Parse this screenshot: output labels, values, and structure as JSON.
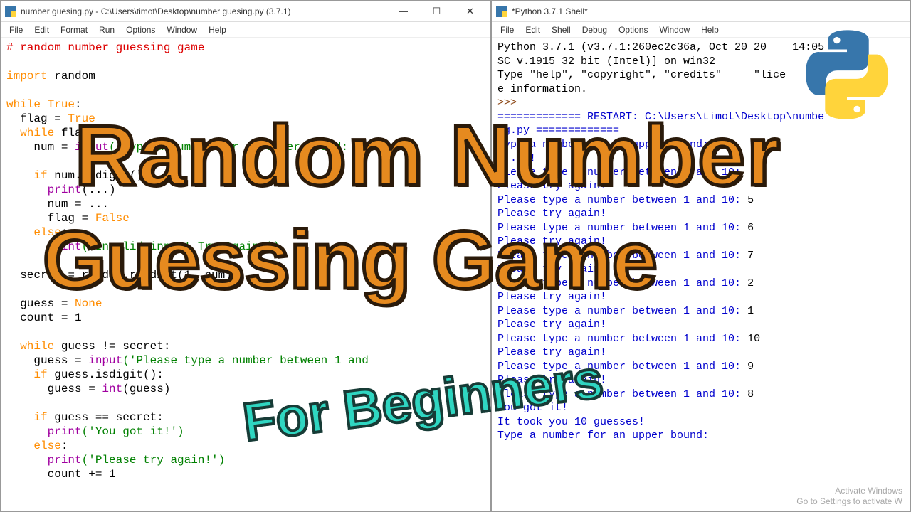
{
  "editor_window": {
    "title": "number guesing.py - C:\\Users\\timot\\Desktop\\number guesing.py (3.7.1)",
    "menu": [
      "File",
      "Edit",
      "Format",
      "Run",
      "Options",
      "Window",
      "Help"
    ],
    "code": {
      "l1_comment": "# random number guessing game",
      "l3_import": "import",
      "l3_random": " random",
      "l5_while": "while",
      "l5_true": " True",
      "l6_flag": "  flag = ",
      "l6_true": "True",
      "l7_while": "  while",
      "l7_flag": " flag:",
      "l8_num": "    num = ",
      "l8_input": "input",
      "l8_str": "('Type a number for an upper bound: ')",
      "l10_if": "    if",
      "l10_rest": " num.isdigit():",
      "l11_print": "      print",
      "l11_rest": "(...)",
      "l12_num": "      num = ...",
      "l13_flag": "      flag = ",
      "l13_false": "False",
      "l14_else": "    else",
      "l15_print": "      print",
      "l15_str": "('Invalid input! Try Again!')",
      "l17_secret": "  secret = ",
      "l17_rest": "random.randint(1, num)",
      "l19_guess": "  guess = ",
      "l19_none": "None",
      "l20_count": "  count = 1",
      "l22_while": "  while",
      "l22_rest": " guess != secret:",
      "l23_guess": "    guess = ",
      "l23_input": "input",
      "l23_str": "('Please type a number between 1 and ",
      "l24_if": "    if",
      "l24_rest": " guess.isdigit():",
      "l25_guess": "      guess = ",
      "l25_int": "int",
      "l25_rest": "(guess)",
      "l27_if": "    if",
      "l27_rest": " guess == secret:",
      "l28_print": "      print",
      "l28_str": "('You got it!')",
      "l29_else": "    else",
      "l30_print": "      print",
      "l30_str": "('Please try again!')",
      "l31_count": "      count += 1"
    }
  },
  "shell_window": {
    "title": "*Python 3.7.1 Shell*",
    "menu": [
      "File",
      "Edit",
      "Shell",
      "Debug",
      "Options",
      "Window",
      "Help"
    ],
    "header1": "Python 3.7.1 (v3.7.1:260ec2c36a, Oct 20 20    14:05",
    "header2": "SC v.1915 32 bit (Intel)] on win32",
    "header3": "Type \"help\", \"copyright\", \"credits\"     \"lice    \"",
    "header4": "e information.",
    "prompt": ">>> ",
    "restart": "============= RESTART: C:\\Users\\timot\\Desktop\\numbe",
    "restart2": "ng.py =============",
    "lines": [
      {
        "t": "prompt",
        "text": "Type a number for an upper bound: ",
        "val": "10"
      },
      {
        "t": "out",
        "text": "...ay!"
      },
      {
        "t": "prompt",
        "text": "Please type a number between 1 and 10: ",
        "val": ""
      },
      {
        "t": "out",
        "text": "Please try again!"
      },
      {
        "t": "prompt",
        "text": "Please type a number between 1 and 10: ",
        "val": "5"
      },
      {
        "t": "out",
        "text": "Please try again!"
      },
      {
        "t": "prompt",
        "text": "Please type a number between 1 and 10: ",
        "val": "6"
      },
      {
        "t": "out",
        "text": "Please try again!"
      },
      {
        "t": "prompt",
        "text": "Please type a number between 1 and 10: ",
        "val": "7"
      },
      {
        "t": "out",
        "text": "Please try again!"
      },
      {
        "t": "prompt",
        "text": "Please type a number between 1 and 10: ",
        "val": "2"
      },
      {
        "t": "out",
        "text": "Please try again!"
      },
      {
        "t": "prompt",
        "text": "Please type a number between 1 and 10: ",
        "val": "1"
      },
      {
        "t": "out",
        "text": "Please try again!"
      },
      {
        "t": "prompt",
        "text": "Please type a number between 1 and 10: ",
        "val": "10"
      },
      {
        "t": "out",
        "text": "Please try again!"
      },
      {
        "t": "prompt",
        "text": "Please type a number between 1 and 10: ",
        "val": "9"
      },
      {
        "t": "out",
        "text": "Please try again!"
      },
      {
        "t": "prompt",
        "text": "Please type a number between 1 and 10: ",
        "val": "8"
      },
      {
        "t": "out",
        "text": "You got it!"
      },
      {
        "t": "out",
        "text": "It took you 10 guesses!"
      },
      {
        "t": "prompt",
        "text": "Type a number for an upper bound: ",
        "val": ""
      }
    ]
  },
  "overlay": {
    "line1": "Random Number",
    "line2": "Guessing Game",
    "line3": "For Beginners"
  },
  "watermark": {
    "l1": "Activate Windows",
    "l2": "Go to Settings to activate W"
  },
  "controls": {
    "min": "—",
    "max": "☐",
    "close": "✕"
  }
}
